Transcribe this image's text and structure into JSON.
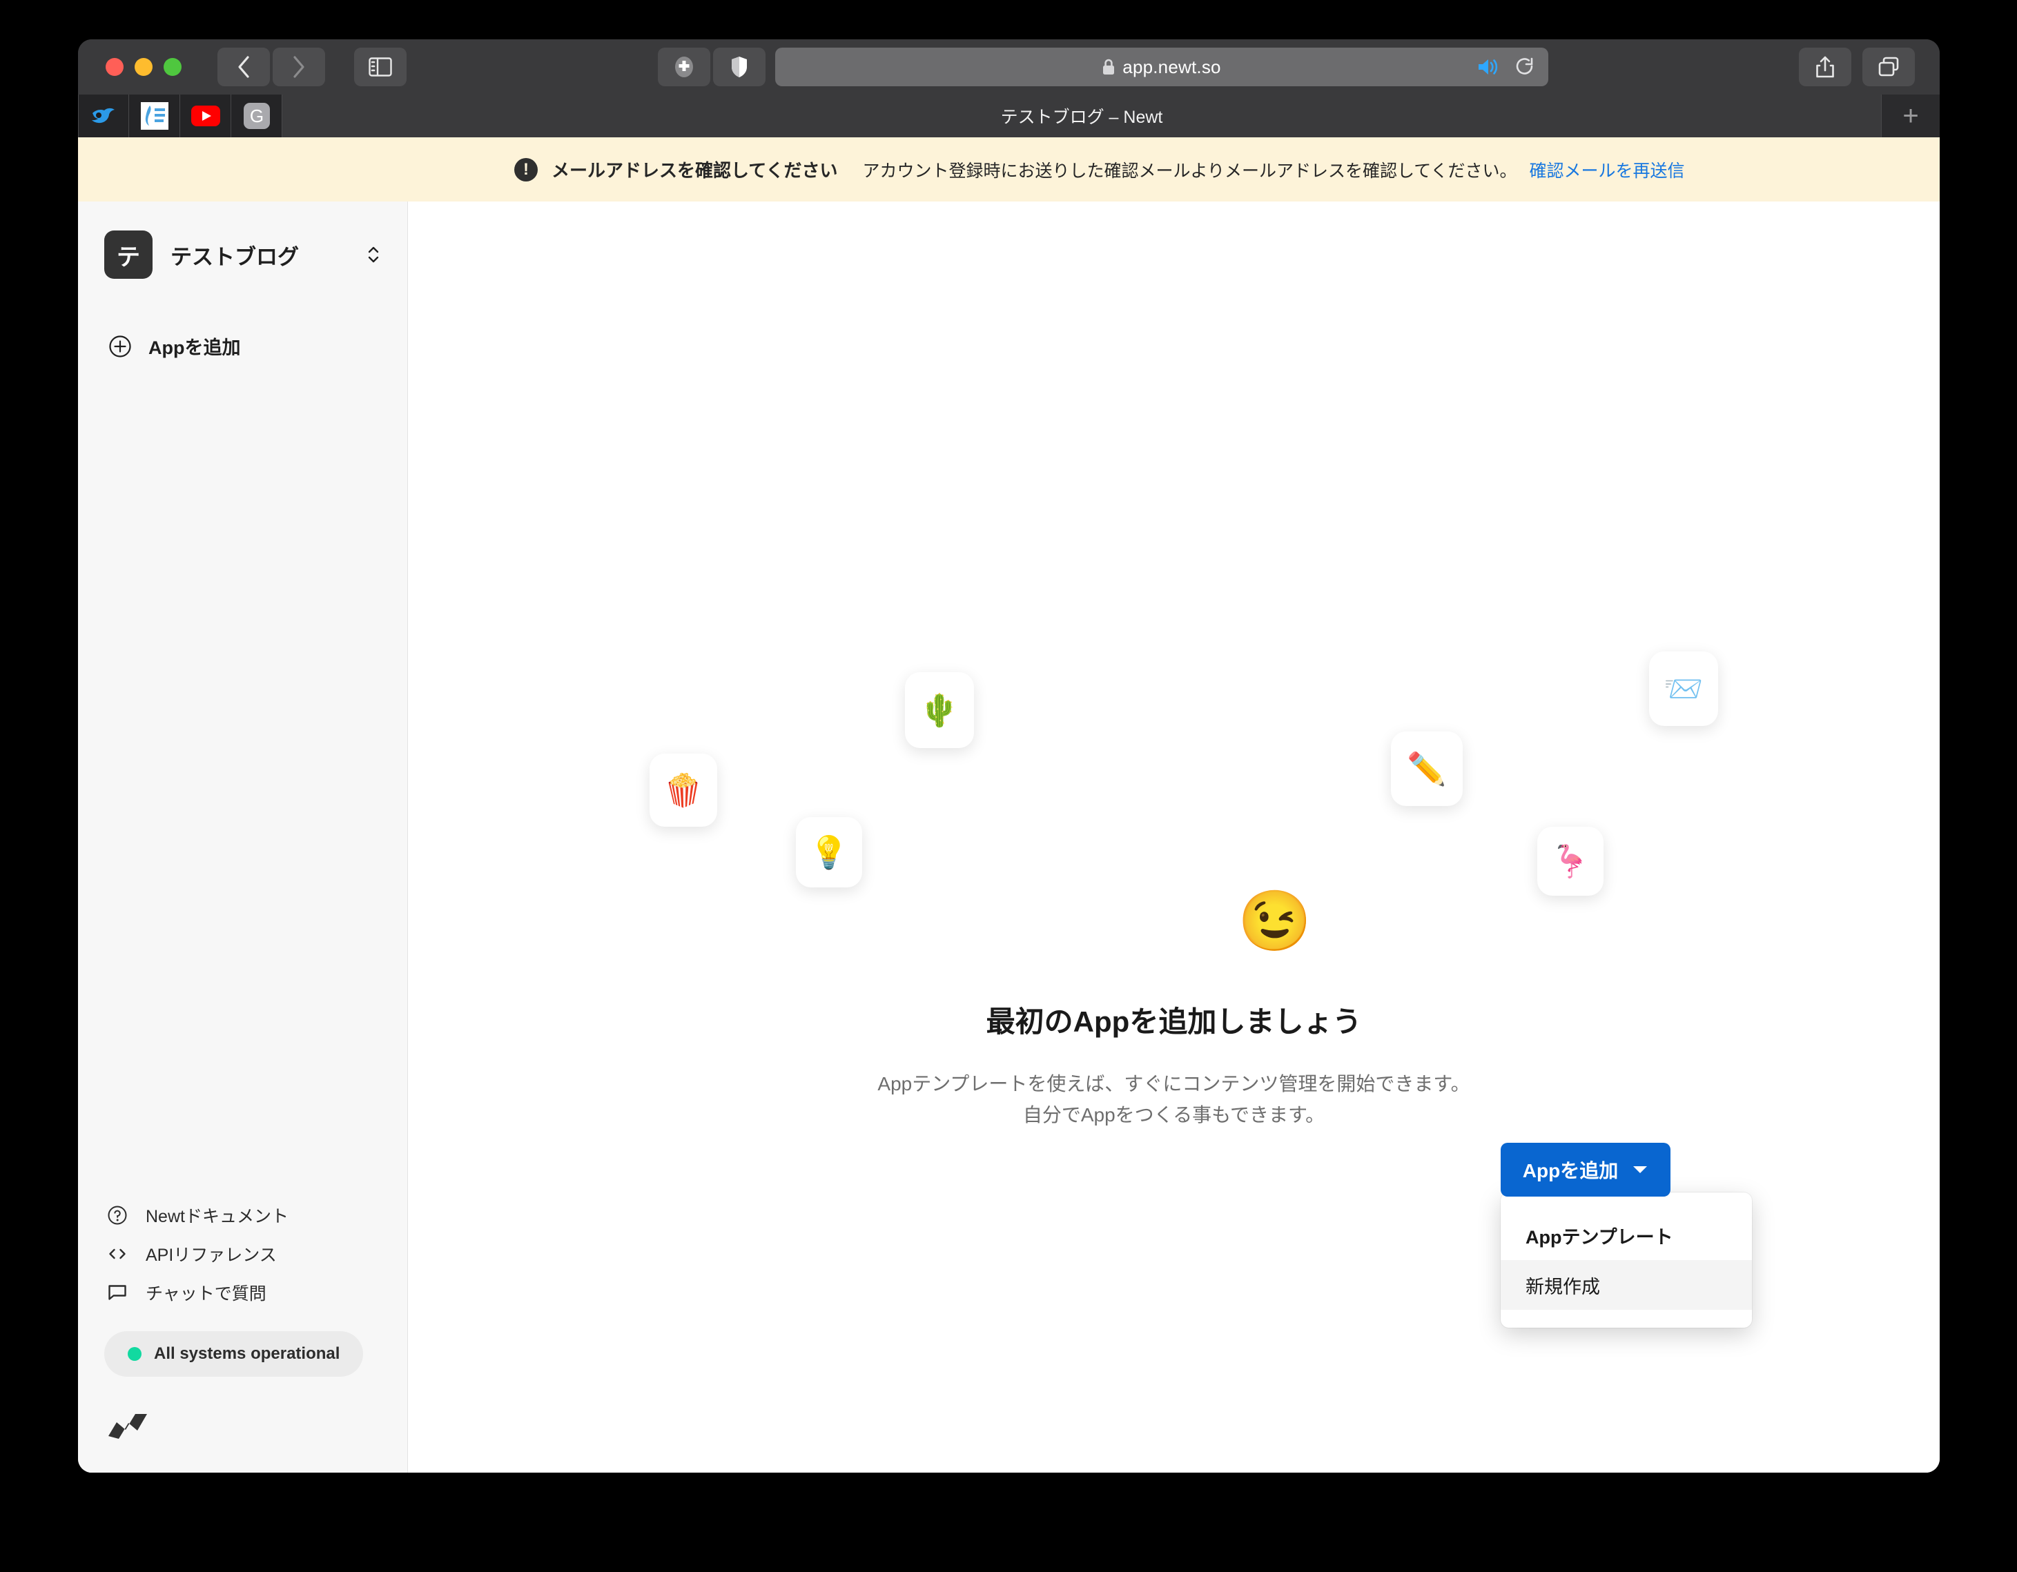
{
  "browser": {
    "address": "app.newt.so",
    "lock_icon": "lock-icon",
    "back_icon": "chevron-left-icon",
    "forward_icon": "chevron-right-icon",
    "sidebar_toggle_icon": "sidebar-toggle-icon",
    "extension_icon": "puzzle-extension-icon",
    "shield_icon": "shield-privacy-icon",
    "audio_icon": "speaker-audio-icon",
    "reload_icon": "reload-icon",
    "share_icon": "share-icon",
    "tabs_overview_icon": "tab-overview-icon",
    "new_tab_label": "+",
    "active_tab_title": "テストブログ – Newt",
    "favicon_tabs": [
      {
        "name": "twitter-bird-favicon",
        "glyph": "🐦"
      },
      {
        "name": "corona-map-favicon",
        "glyph": "🗾"
      },
      {
        "name": "youtube-favicon",
        "glyph": "▶"
      },
      {
        "name": "google-favicon",
        "glyph": "G"
      }
    ]
  },
  "banner": {
    "icon": "alert-exclamation-icon",
    "title": "メールアドレスを確認してください",
    "description": "アカウント登録時にお送りした確認メールよりメールアドレスを確認してください。",
    "action_label": "確認メールを再送信",
    "background_color": "#fdf3d9",
    "link_color": "#1777e0"
  },
  "sidebar": {
    "workspace": {
      "avatar_letter": "テ",
      "name": "テストブログ",
      "switcher_icon": "chevron-up-down-icon"
    },
    "add_app": {
      "icon": "plus-circle-icon",
      "label": "Appを追加"
    },
    "help_links": [
      {
        "icon": "question-circle-icon",
        "label": "Newtドキュメント"
      },
      {
        "icon": "code-brackets-icon",
        "label": "APIリファレンス"
      },
      {
        "icon": "chat-bubble-icon",
        "label": "チャットで質問"
      }
    ],
    "status": {
      "dot_color": "#12d9a0",
      "label": "All systems operational"
    },
    "logo_name": "newt-logo"
  },
  "main": {
    "hero_emoji": "😉",
    "title": "最初のAppを追加しましょう",
    "subtitle_line1": "Appテンプレートを使えば、すぐにコンテンツ管理を開始できます。",
    "subtitle_line2": "自分でAppをつくる事もできます。",
    "cta": {
      "label": "Appを追加",
      "caret_icon": "caret-down-icon",
      "color": "#0966d0"
    },
    "dropdown": {
      "items": [
        {
          "label": "Appテンプレート",
          "highlighted": false
        },
        {
          "label": "新規作成",
          "highlighted": true
        }
      ]
    },
    "decor_cards": [
      {
        "name": "popcorn-card",
        "emoji": "🍿"
      },
      {
        "name": "cactus-card",
        "emoji": "🌵"
      },
      {
        "name": "lightbulb-card",
        "emoji": "💡"
      },
      {
        "name": "pencil-card",
        "emoji": "✏️"
      },
      {
        "name": "flamingo-card",
        "emoji": "🦩"
      },
      {
        "name": "incoming-mail-card",
        "emoji": "📨"
      }
    ]
  }
}
